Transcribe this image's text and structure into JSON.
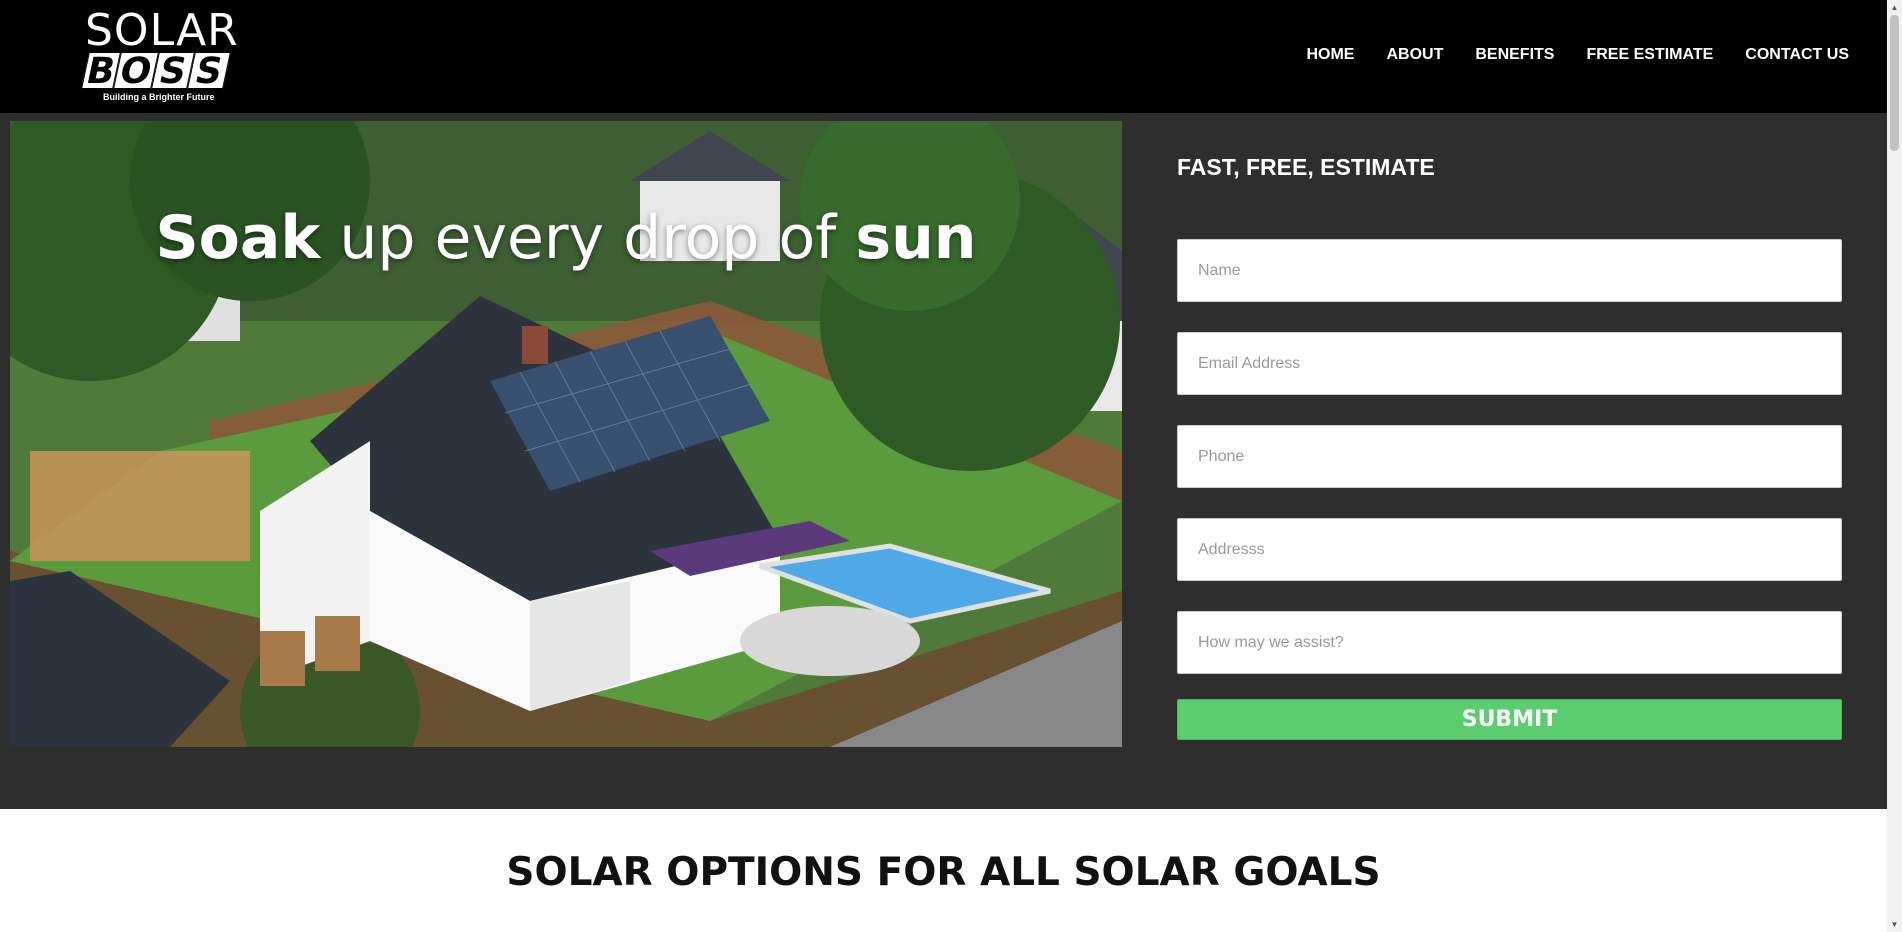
{
  "brand": {
    "logo_top": "SOLAR",
    "logo_letters": [
      "B",
      "O",
      "S",
      "S"
    ],
    "tagline": "Building a Brighter Future"
  },
  "nav": {
    "items": [
      "HOME",
      "ABOUT",
      "BENEFITS",
      "FREE ESTIMATE",
      "CONTACT US"
    ]
  },
  "hero": {
    "headline": {
      "part1": "Soak",
      "part2": " up every drop of ",
      "part3": "sun"
    }
  },
  "form": {
    "title": "FAST, FREE, ESTIMATE",
    "name_placeholder": "Name",
    "email_placeholder": "Email Address",
    "phone_placeholder": "Phone",
    "address_placeholder": "Addresss",
    "message_placeholder": "How may we assist?",
    "submit_label": "SUBMIT"
  },
  "options": {
    "heading": "SOLAR OPTIONS FOR ALL SOLAR GOALS"
  },
  "colors": {
    "header_bg": "#000000",
    "hero_bg": "#2e2e2e",
    "submit_green": "#5ccd6e"
  }
}
